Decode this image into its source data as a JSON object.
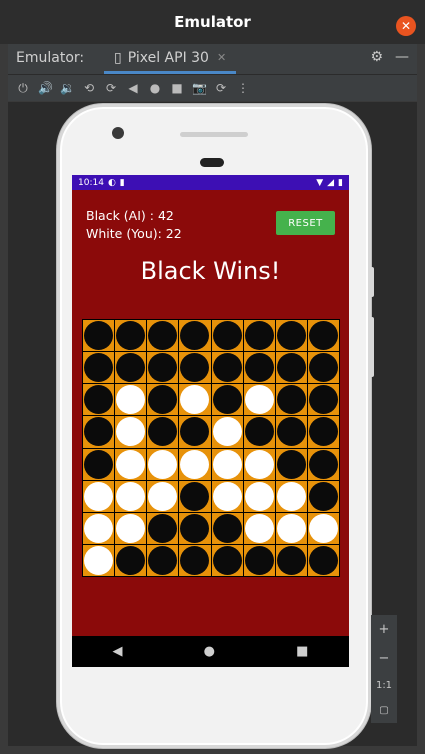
{
  "window": {
    "title": "Emulator"
  },
  "tabs": {
    "label": "Emulator:",
    "active_tab": "Pixel API 30"
  },
  "toolbar": {
    "icons": [
      "power-icon",
      "volume-up-icon",
      "volume-down-icon",
      "rotate-left-icon",
      "rotate-right-icon",
      "back-icon",
      "home-icon",
      "overview-icon",
      "camera-icon",
      "snapshot-icon",
      "more-icon"
    ]
  },
  "status_bar": {
    "time": "10:14",
    "bg_color": "#3d0fb4"
  },
  "game": {
    "black_score": "Black (AI) : 42",
    "white_score": "White (You): 22",
    "reset_label": "RESET",
    "result": "Black Wins!",
    "background_color": "#8b0a0a",
    "board_color": "#e7920a",
    "board": [
      [
        "B",
        "B",
        "B",
        "B",
        "B",
        "B",
        "B",
        "B"
      ],
      [
        "B",
        "B",
        "B",
        "B",
        "B",
        "B",
        "B",
        "B"
      ],
      [
        "B",
        "W",
        "B",
        "W",
        "B",
        "W",
        "B",
        "B"
      ],
      [
        "B",
        "W",
        "B",
        "B",
        "W",
        "B",
        "B",
        "B"
      ],
      [
        "B",
        "W",
        "W",
        "W",
        "W",
        "W",
        "B",
        "B"
      ],
      [
        "W",
        "W",
        "W",
        "B",
        "W",
        "W",
        "W",
        "B"
      ],
      [
        "W",
        "W",
        "B",
        "B",
        "B",
        "W",
        "W",
        "W"
      ],
      [
        "W",
        "B",
        "B",
        "B",
        "B",
        "B",
        "B",
        "B"
      ]
    ]
  },
  "zoom_controls": {
    "plus": "+",
    "minus": "−",
    "one_to_one": "1:1"
  }
}
